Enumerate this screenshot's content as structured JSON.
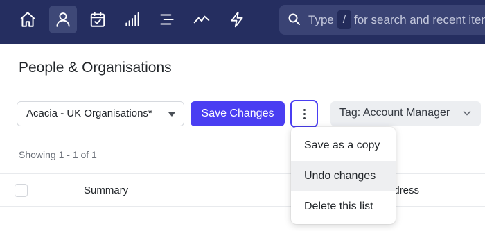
{
  "nav": {
    "items": [
      {
        "icon": "home-icon"
      },
      {
        "icon": "person-icon",
        "active": true
      },
      {
        "icon": "calendar-check-icon"
      },
      {
        "icon": "bar-signal-icon"
      },
      {
        "icon": "menu-lines-icon"
      },
      {
        "icon": "trend-line-icon"
      },
      {
        "icon": "lightning-icon"
      }
    ],
    "search": {
      "icon": "search-icon",
      "prefix": "Type",
      "shortcut": "/",
      "suffix": "for search and recent items"
    }
  },
  "page": {
    "title": "People & Organisations"
  },
  "toolbar": {
    "list_select": "Acacia - UK Organisations*",
    "save_label": "Save Changes",
    "more_icon": "more-vertical-icon",
    "tag_label": "Tag:",
    "tag_value": "Account Manager"
  },
  "results": {
    "showing": "Showing 1 - 1 of 1"
  },
  "table": {
    "columns": [
      "Summary",
      "Address"
    ]
  },
  "menu": {
    "items": [
      {
        "label": "Save as a copy"
      },
      {
        "label": "Undo changes",
        "highlighted": true
      },
      {
        "label": "Delete this list"
      }
    ]
  },
  "colors": {
    "nav_bg": "#252e60",
    "accent": "#4a3ef2",
    "search_bg": "#3a4374"
  }
}
